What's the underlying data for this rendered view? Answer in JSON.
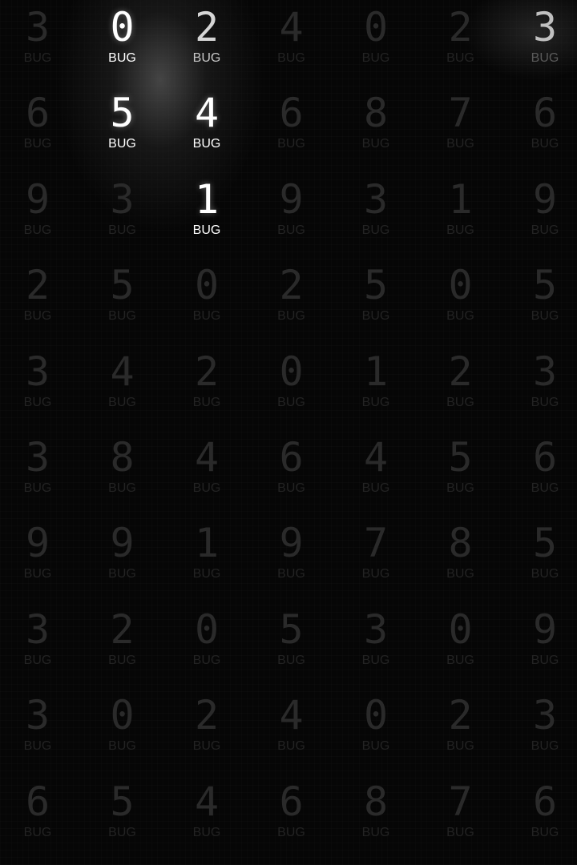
{
  "grid": {
    "label": "BUG",
    "rows": [
      [
        "3",
        "0",
        "2",
        "4",
        "0",
        "2",
        "3"
      ],
      [
        "6",
        "5",
        "4",
        "6",
        "8",
        "7",
        "6"
      ],
      [
        "9",
        "3",
        "1",
        "9",
        "3",
        "1",
        "9"
      ],
      [
        "2",
        "5",
        "0",
        "2",
        "5",
        "0",
        "5"
      ],
      [
        "3",
        "4",
        "2",
        "0",
        "1",
        "2",
        "3"
      ],
      [
        "3",
        "8",
        "4",
        "6",
        "4",
        "5",
        "6"
      ],
      [
        "9",
        "9",
        "1",
        "9",
        "7",
        "8",
        "5"
      ],
      [
        "3",
        "2",
        "0",
        "5",
        "3",
        "0",
        "9"
      ],
      [
        "3",
        "0",
        "2",
        "4",
        "0",
        "2",
        "3"
      ],
      [
        "6",
        "5",
        "4",
        "6",
        "8",
        "7",
        "6"
      ]
    ],
    "revealed": [
      [
        0,
        1
      ],
      [
        0,
        2
      ],
      [
        1,
        1
      ],
      [
        1,
        2
      ],
      [
        2,
        2
      ]
    ],
    "partially_lit": [
      [
        0,
        6
      ]
    ]
  },
  "colors": {
    "background": "#060606",
    "dim_text": "#2a2a2a",
    "lit_text": "#ffffff"
  }
}
